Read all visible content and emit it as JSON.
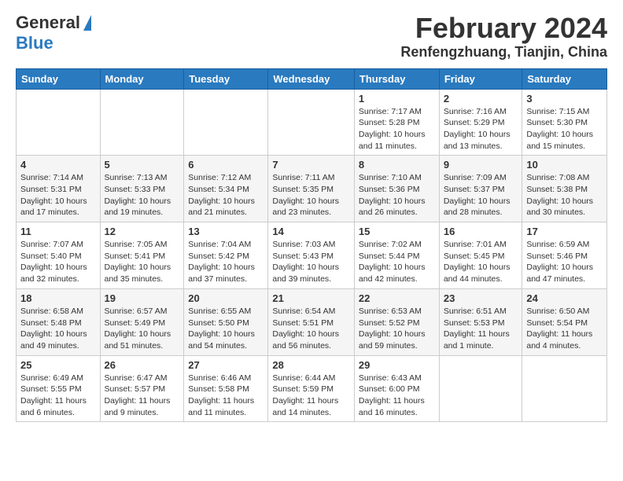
{
  "header": {
    "logo_general": "General",
    "logo_blue": "Blue",
    "month_title": "February 2024",
    "location": "Renfengzhuang, Tianjin, China"
  },
  "weekdays": [
    "Sunday",
    "Monday",
    "Tuesday",
    "Wednesday",
    "Thursday",
    "Friday",
    "Saturday"
  ],
  "weeks": [
    [
      {
        "day": "",
        "info": ""
      },
      {
        "day": "",
        "info": ""
      },
      {
        "day": "",
        "info": ""
      },
      {
        "day": "",
        "info": ""
      },
      {
        "day": "1",
        "info": "Sunrise: 7:17 AM\nSunset: 5:28 PM\nDaylight: 10 hours and 11 minutes."
      },
      {
        "day": "2",
        "info": "Sunrise: 7:16 AM\nSunset: 5:29 PM\nDaylight: 10 hours and 13 minutes."
      },
      {
        "day": "3",
        "info": "Sunrise: 7:15 AM\nSunset: 5:30 PM\nDaylight: 10 hours and 15 minutes."
      }
    ],
    [
      {
        "day": "4",
        "info": "Sunrise: 7:14 AM\nSunset: 5:31 PM\nDaylight: 10 hours and 17 minutes."
      },
      {
        "day": "5",
        "info": "Sunrise: 7:13 AM\nSunset: 5:33 PM\nDaylight: 10 hours and 19 minutes."
      },
      {
        "day": "6",
        "info": "Sunrise: 7:12 AM\nSunset: 5:34 PM\nDaylight: 10 hours and 21 minutes."
      },
      {
        "day": "7",
        "info": "Sunrise: 7:11 AM\nSunset: 5:35 PM\nDaylight: 10 hours and 23 minutes."
      },
      {
        "day": "8",
        "info": "Sunrise: 7:10 AM\nSunset: 5:36 PM\nDaylight: 10 hours and 26 minutes."
      },
      {
        "day": "9",
        "info": "Sunrise: 7:09 AM\nSunset: 5:37 PM\nDaylight: 10 hours and 28 minutes."
      },
      {
        "day": "10",
        "info": "Sunrise: 7:08 AM\nSunset: 5:38 PM\nDaylight: 10 hours and 30 minutes."
      }
    ],
    [
      {
        "day": "11",
        "info": "Sunrise: 7:07 AM\nSunset: 5:40 PM\nDaylight: 10 hours and 32 minutes."
      },
      {
        "day": "12",
        "info": "Sunrise: 7:05 AM\nSunset: 5:41 PM\nDaylight: 10 hours and 35 minutes."
      },
      {
        "day": "13",
        "info": "Sunrise: 7:04 AM\nSunset: 5:42 PM\nDaylight: 10 hours and 37 minutes."
      },
      {
        "day": "14",
        "info": "Sunrise: 7:03 AM\nSunset: 5:43 PM\nDaylight: 10 hours and 39 minutes."
      },
      {
        "day": "15",
        "info": "Sunrise: 7:02 AM\nSunset: 5:44 PM\nDaylight: 10 hours and 42 minutes."
      },
      {
        "day": "16",
        "info": "Sunrise: 7:01 AM\nSunset: 5:45 PM\nDaylight: 10 hours and 44 minutes."
      },
      {
        "day": "17",
        "info": "Sunrise: 6:59 AM\nSunset: 5:46 PM\nDaylight: 10 hours and 47 minutes."
      }
    ],
    [
      {
        "day": "18",
        "info": "Sunrise: 6:58 AM\nSunset: 5:48 PM\nDaylight: 10 hours and 49 minutes."
      },
      {
        "day": "19",
        "info": "Sunrise: 6:57 AM\nSunset: 5:49 PM\nDaylight: 10 hours and 51 minutes."
      },
      {
        "day": "20",
        "info": "Sunrise: 6:55 AM\nSunset: 5:50 PM\nDaylight: 10 hours and 54 minutes."
      },
      {
        "day": "21",
        "info": "Sunrise: 6:54 AM\nSunset: 5:51 PM\nDaylight: 10 hours and 56 minutes."
      },
      {
        "day": "22",
        "info": "Sunrise: 6:53 AM\nSunset: 5:52 PM\nDaylight: 10 hours and 59 minutes."
      },
      {
        "day": "23",
        "info": "Sunrise: 6:51 AM\nSunset: 5:53 PM\nDaylight: 11 hours and 1 minute."
      },
      {
        "day": "24",
        "info": "Sunrise: 6:50 AM\nSunset: 5:54 PM\nDaylight: 11 hours and 4 minutes."
      }
    ],
    [
      {
        "day": "25",
        "info": "Sunrise: 6:49 AM\nSunset: 5:55 PM\nDaylight: 11 hours and 6 minutes."
      },
      {
        "day": "26",
        "info": "Sunrise: 6:47 AM\nSunset: 5:57 PM\nDaylight: 11 hours and 9 minutes."
      },
      {
        "day": "27",
        "info": "Sunrise: 6:46 AM\nSunset: 5:58 PM\nDaylight: 11 hours and 11 minutes."
      },
      {
        "day": "28",
        "info": "Sunrise: 6:44 AM\nSunset: 5:59 PM\nDaylight: 11 hours and 14 minutes."
      },
      {
        "day": "29",
        "info": "Sunrise: 6:43 AM\nSunset: 6:00 PM\nDaylight: 11 hours and 16 minutes."
      },
      {
        "day": "",
        "info": ""
      },
      {
        "day": "",
        "info": ""
      }
    ]
  ]
}
